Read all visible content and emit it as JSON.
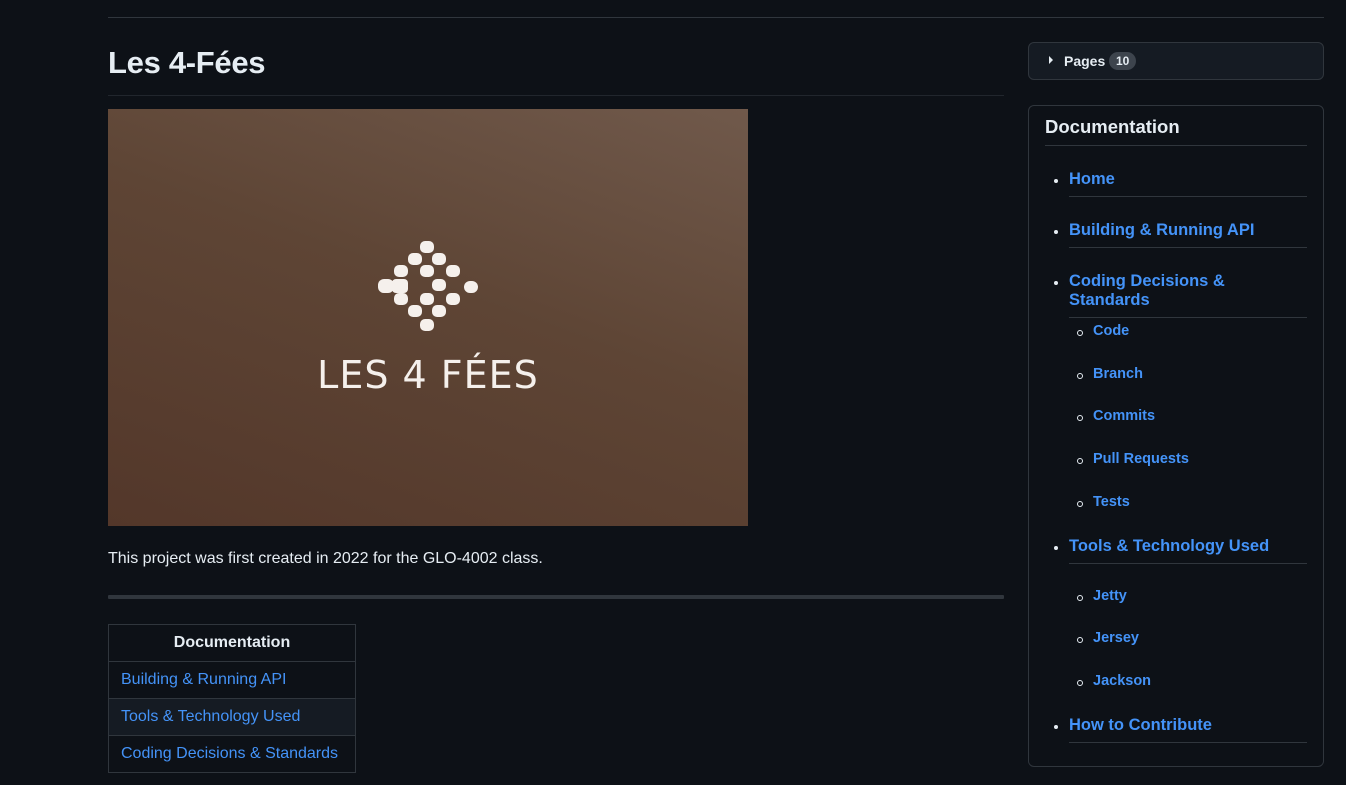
{
  "page": {
    "title": "Les 4-Fées",
    "banner_text": "LES 4 FÉES",
    "description": "This project was first created in 2022 for the GLO-4002 class."
  },
  "table": {
    "header": "Documentation",
    "rows": [
      "Building & Running API",
      "Tools & Technology Used",
      "Coding Decisions & Standards"
    ]
  },
  "sidebar": {
    "pages_label": "Pages",
    "pages_count": "10",
    "doc_title": "Documentation",
    "items": [
      {
        "label": "Home"
      },
      {
        "label": "Building & Running API"
      },
      {
        "label": "Coding Decisions & Standards"
      },
      {
        "label": "Code"
      },
      {
        "label": "Branch"
      },
      {
        "label": "Commits"
      },
      {
        "label": "Pull Requests"
      },
      {
        "label": "Tests"
      },
      {
        "label": "Tools & Technology Used"
      },
      {
        "label": "Jetty"
      },
      {
        "label": "Jersey"
      },
      {
        "label": "Jackson"
      },
      {
        "label": "How to Contribute"
      }
    ]
  },
  "colors": {
    "link": "#4493f8",
    "background": "#0d1117",
    "border": "#30363d"
  }
}
